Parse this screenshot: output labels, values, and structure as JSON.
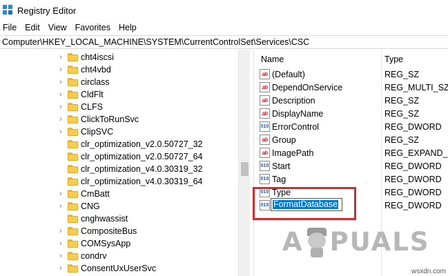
{
  "window": {
    "title": "Registry Editor"
  },
  "menu": [
    "File",
    "Edit",
    "View",
    "Favorites",
    "Help"
  ],
  "address": "Computer\\HKEY_LOCAL_MACHINE\\SYSTEM\\CurrentControlSet\\Services\\CSC",
  "tree": {
    "items": [
      {
        "label": "cht4iscsi",
        "expandable": true
      },
      {
        "label": "cht4vbd",
        "expandable": true
      },
      {
        "label": "circlass",
        "expandable": true
      },
      {
        "label": "CldFlt",
        "expandable": true
      },
      {
        "label": "CLFS",
        "expandable": true
      },
      {
        "label": "ClickToRunSvc",
        "expandable": true
      },
      {
        "label": "ClipSVC",
        "expandable": true
      },
      {
        "label": "clr_optimization_v2.0.50727_32",
        "expandable": false
      },
      {
        "label": "clr_optimization_v2.0.50727_64",
        "expandable": false
      },
      {
        "label": "clr_optimization_v4.0.30319_32",
        "expandable": false
      },
      {
        "label": "clr_optimization_v4.0.30319_64",
        "expandable": false
      },
      {
        "label": "CmBatt",
        "expandable": true
      },
      {
        "label": "CNG",
        "expandable": true
      },
      {
        "label": "cnghwassist",
        "expandable": false
      },
      {
        "label": "CompositeBus",
        "expandable": true
      },
      {
        "label": "COMSysApp",
        "expandable": true
      },
      {
        "label": "condrv",
        "expandable": true
      },
      {
        "label": "ConsentUxUserSvc",
        "expandable": true
      }
    ]
  },
  "values": {
    "columns": {
      "name": "Name",
      "type": "Type"
    },
    "rows": [
      {
        "name": "(Default)",
        "type": "REG_SZ",
        "kind": "sz"
      },
      {
        "name": "DependOnService",
        "type": "REG_MULTI_SZ",
        "kind": "sz"
      },
      {
        "name": "Description",
        "type": "REG_SZ",
        "kind": "sz"
      },
      {
        "name": "DisplayName",
        "type": "REG_SZ",
        "kind": "sz"
      },
      {
        "name": "ErrorControl",
        "type": "REG_DWORD",
        "kind": "dword"
      },
      {
        "name": "Group",
        "type": "REG_SZ",
        "kind": "sz"
      },
      {
        "name": "ImagePath",
        "type": "REG_EXPAND_SZ",
        "kind": "sz"
      },
      {
        "name": "Start",
        "type": "REG_DWORD",
        "kind": "dword"
      },
      {
        "name": "Tag",
        "type": "REG_DWORD",
        "kind": "dword"
      },
      {
        "name": "Type",
        "type": "REG_DWORD",
        "kind": "dword"
      },
      {
        "name": "FormatDatabase",
        "type": "REG_DWORD",
        "kind": "dword",
        "editing": true
      }
    ]
  },
  "watermark": {
    "logo_left": "A",
    "logo_right": "PUALS",
    "site": "wsxdn.com"
  },
  "colors": {
    "highlight_border": "#d9282b",
    "selection": "#0078d7",
    "folder": "#f5cd52"
  }
}
